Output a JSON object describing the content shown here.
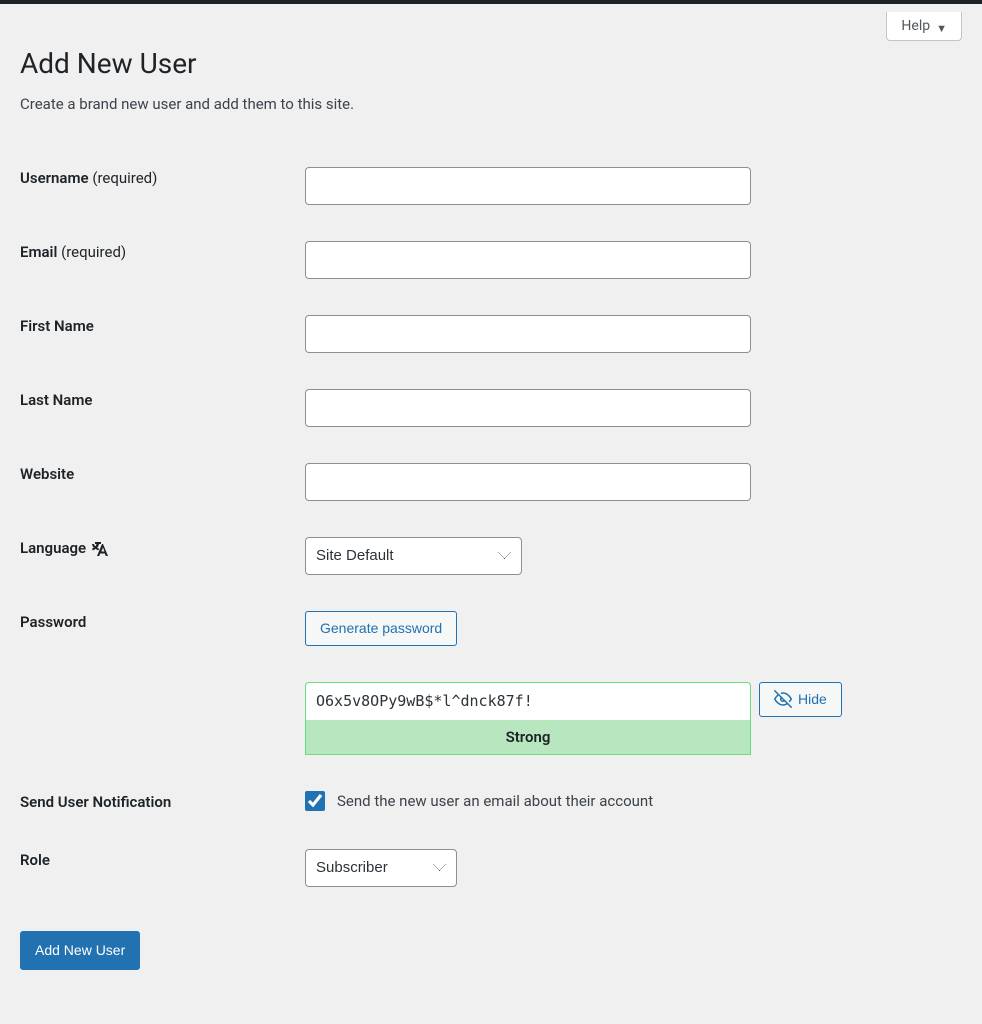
{
  "help": {
    "label": "Help"
  },
  "page": {
    "title": "Add New User",
    "description": "Create a brand new user and add them to this site."
  },
  "form": {
    "username": {
      "label": "Username",
      "required_suffix": "(required)",
      "value": ""
    },
    "email": {
      "label": "Email",
      "required_suffix": "(required)",
      "value": ""
    },
    "first_name": {
      "label": "First Name",
      "value": ""
    },
    "last_name": {
      "label": "Last Name",
      "value": ""
    },
    "website": {
      "label": "Website",
      "value": ""
    },
    "language": {
      "label": "Language",
      "icon_name": "translate-icon",
      "selected": "Site Default"
    },
    "password": {
      "label": "Password",
      "generate_button": "Generate password",
      "value": "O6x5v8OPy9wB$*l^dnck87f!",
      "strength_text": "Strong",
      "hide_button": "Hide"
    },
    "notification": {
      "label": "Send User Notification",
      "checked": true,
      "text": "Send the new user an email about their account"
    },
    "role": {
      "label": "Role",
      "selected": "Subscriber"
    }
  },
  "submit": {
    "label": "Add New User"
  },
  "colors": {
    "primary": "#2271b1",
    "strength_bg": "#b8e6bf",
    "strength_border": "#68de7c"
  }
}
